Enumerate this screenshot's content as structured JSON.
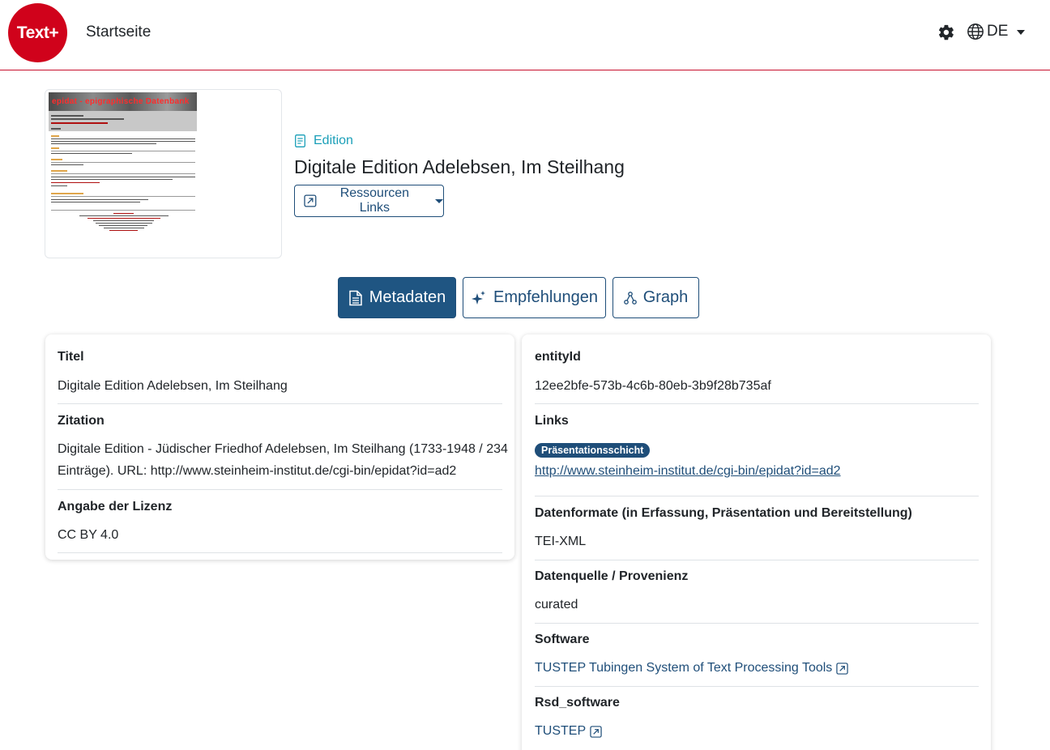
{
  "header": {
    "logo_text": "Text+",
    "home_label": "Startseite",
    "language": "DE",
    "icons": [
      "gear-icon",
      "globe-icon",
      "caret-down-icon"
    ]
  },
  "thumbnail": {
    "banner_text": "epidat - epigraphische Datenbank"
  },
  "resource": {
    "type_label": "Edition",
    "title": "Digitale Edition Adelebsen, Im Steilhang",
    "links_button": "Ressourcen Links"
  },
  "tabs": [
    {
      "label": "Metadaten",
      "icon": "document-icon",
      "active": true
    },
    {
      "label": "Empfehlungen",
      "icon": "sparkles-icon",
      "active": false
    },
    {
      "label": "Graph",
      "icon": "graph-icon",
      "active": false
    }
  ],
  "left_card": {
    "fields": [
      {
        "label": "Titel",
        "value": "Digitale Edition Adelebsen, Im Steilhang"
      },
      {
        "label": "Zitation",
        "value_line1": "Digitale Edition - Jüdischer Friedhof Adelebsen, Im Steilhang (1733-1948 / 234",
        "value_line2": "Einträge). URL: http://www.steinheim-institut.de/cgi-bin/epidat?id=ad2"
      },
      {
        "label": "Angabe der Lizenz",
        "value": "CC BY 4.0"
      }
    ]
  },
  "right_card": {
    "entity_label": "entityId",
    "entity_value": "12ee2bfe-573b-4c6b-80eb-3b9f28b735af",
    "links_label": "Links",
    "links_badge": "Präsentationsschicht",
    "links_url": "http://www.steinheim-institut.de/cgi-bin/epidat?id=ad2",
    "formats_label": "Datenformate (in Erfassung, Präsentation und Bereitstellung)",
    "formats_value": "TEI-XML",
    "source_label": "Datenquelle / Provenienz",
    "source_value": "curated",
    "software_label": "Software",
    "software_value": "TUSTEP Tubingen System of Text Processing Tools",
    "rsd_label": "Rsd_software",
    "rsd_value": "TUSTEP"
  },
  "colors": {
    "brand_red": "#d0021b",
    "primary": "#1f5582",
    "accent_teal": "#1a9fb8"
  }
}
